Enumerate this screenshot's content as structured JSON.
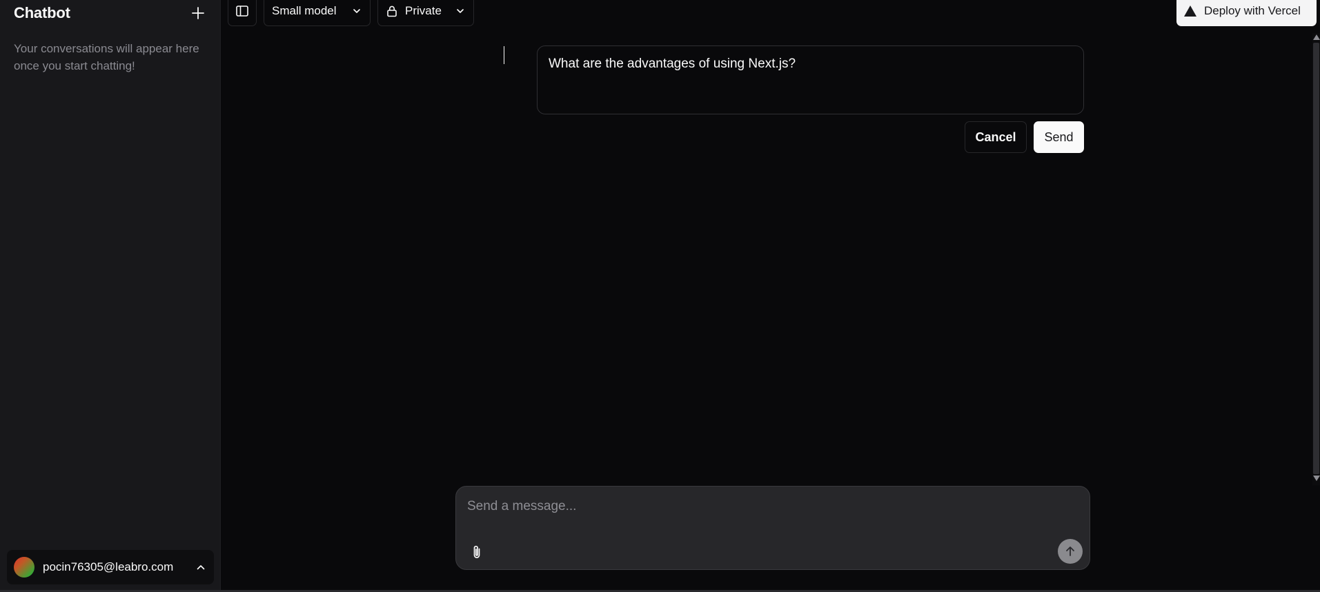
{
  "sidebar": {
    "title": "Chatbot",
    "new_chat_icon": "plus-icon",
    "empty_state": "Your conversations will appear here once you start chatting!",
    "user": {
      "email": "pocin76305@leabro.com",
      "menu_icon": "chevron-up-icon"
    }
  },
  "toolbar": {
    "toggle_icon": "sidebar-toggle-icon",
    "model_label": "Small model",
    "visibility_label": "Private",
    "visibility_icon": "lock-icon",
    "deploy_label": "Deploy with Vercel",
    "deploy_icon": "vercel-triangle-icon"
  },
  "edit": {
    "message_text": "What are the advantages of using Next.js?",
    "cancel_label": "Cancel",
    "send_label": "Send"
  },
  "composer": {
    "placeholder": "Send a message...",
    "attach_icon": "paperclip-icon",
    "submit_icon": "arrow-up-icon"
  },
  "colors": {
    "background": "#09090b",
    "sidebar": "#18181b",
    "composer": "#27272a",
    "primary_button": "#fafafa",
    "muted_text": "#8a8a91"
  }
}
